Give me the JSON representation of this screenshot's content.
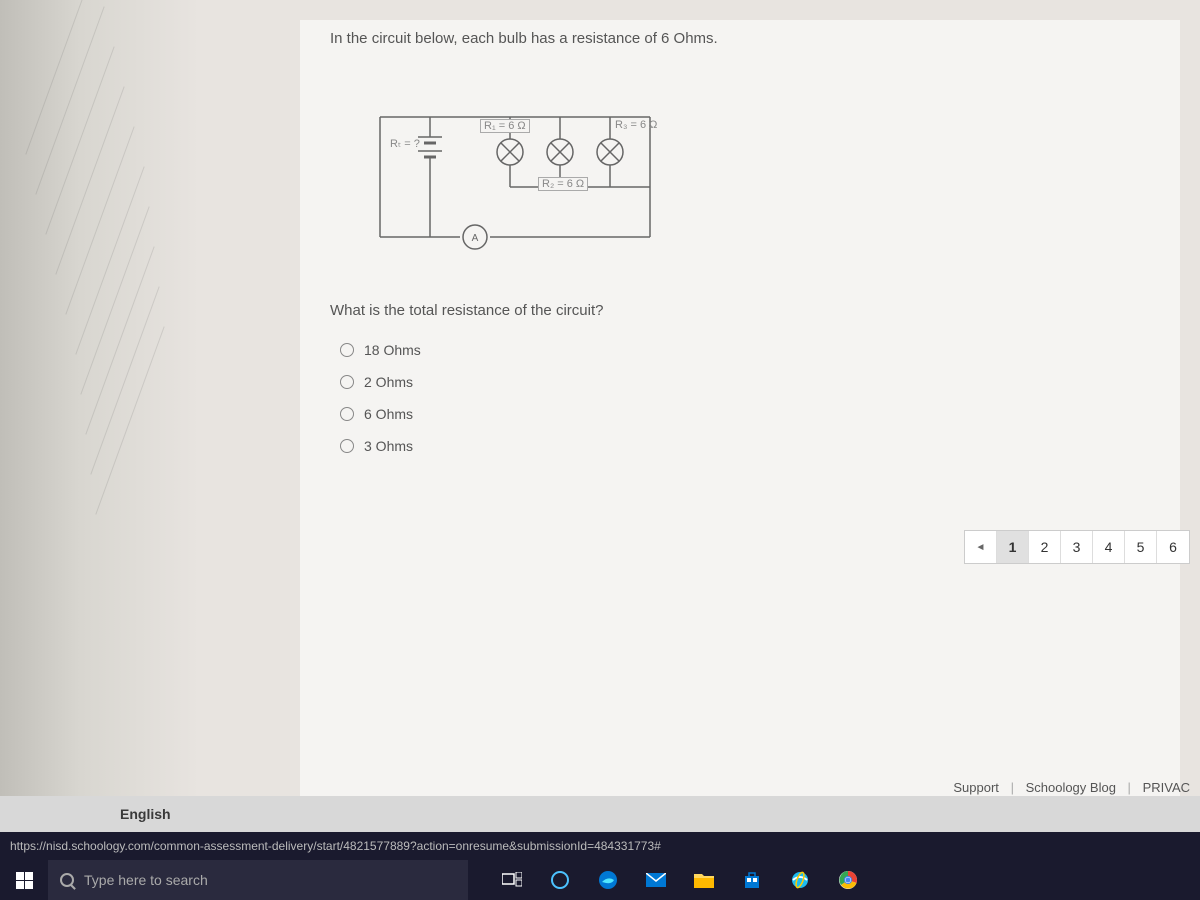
{
  "question": {
    "intro": "In the circuit below, each bulb has a resistance of 6 Ohms.",
    "prompt": "What is the total resistance of the circuit?",
    "options": [
      "18 Ohms",
      "2 Ohms",
      "6 Ohms",
      "3 Ohms"
    ]
  },
  "circuit": {
    "labels": {
      "rt": "Rₜ = ?",
      "r1": "R₁ = 6 Ω",
      "r2": "R₂ = 6 Ω",
      "r3": "R₃ = 6 Ω"
    }
  },
  "pagination": {
    "prev": "◄",
    "pages": [
      "1",
      "2",
      "3",
      "4",
      "5",
      "6"
    ],
    "active": 0
  },
  "footer": {
    "support": "Support",
    "blog": "Schoology Blog",
    "privacy": "PRIVAC",
    "sep": "|"
  },
  "language_bar": "English",
  "status_url": "https://nisd.schoology.com/common-assessment-delivery/start/4821577889?action=onresume&submissionId=484331773#",
  "taskbar": {
    "search_placeholder": "Type here to search"
  }
}
